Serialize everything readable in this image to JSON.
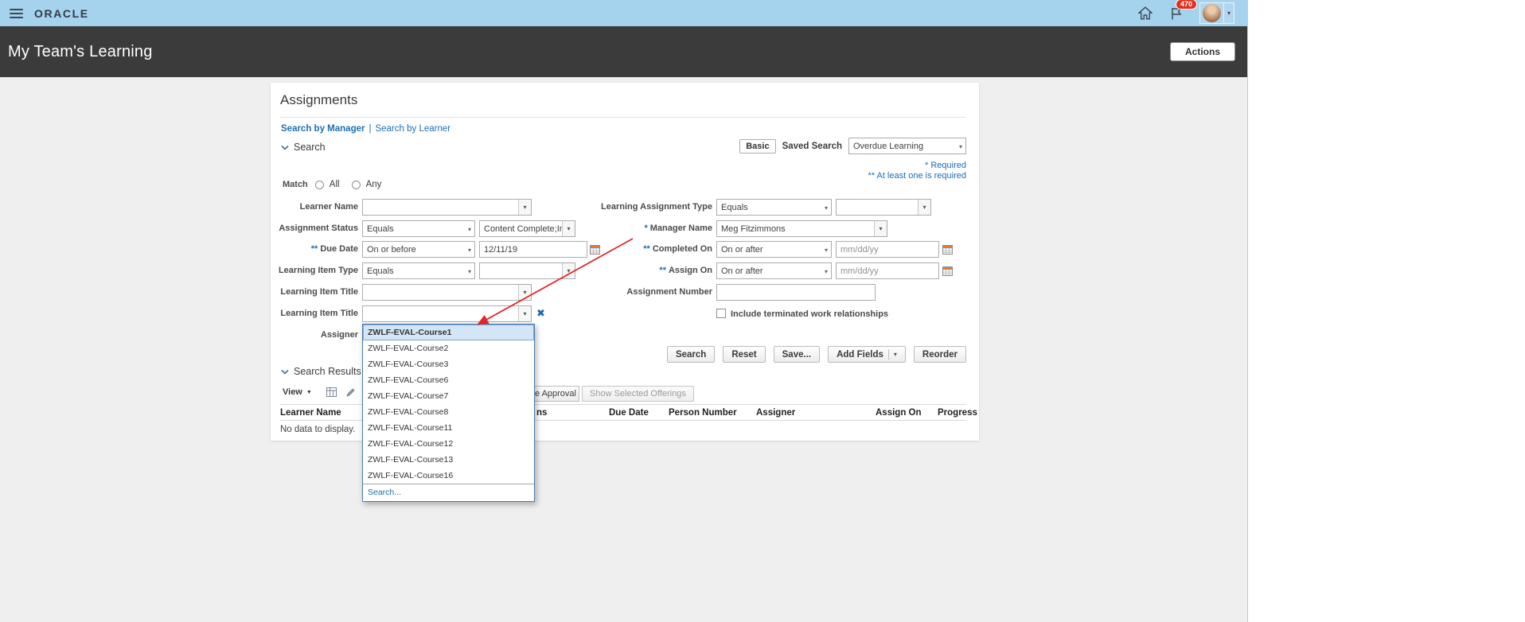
{
  "colors": {
    "topbar_bg": "#A5D2ED",
    "header_bg": "#3B3B3B",
    "link_blue": "#1A6FB5",
    "badge_red": "#E0301E",
    "annotation_arrow_red": "#E32528",
    "selected_item_bg": "#D3E6F7"
  },
  "topbar": {
    "brand": "ORACLE",
    "notification_count": "470"
  },
  "page_header": {
    "title": "My Team's Learning",
    "actions_button": "Actions"
  },
  "assignments": {
    "title": "Assignments",
    "search_by_manager": "Search by Manager",
    "separator": "|",
    "search_by_learner": "Search by Learner"
  },
  "search": {
    "section_title": "Search",
    "basic_button": "Basic",
    "saved_search_label": "Saved Search",
    "saved_search_value": "Overdue Learning",
    "required_note": "* Required",
    "at_least_one_note": "** At least one is required",
    "match_label": "Match",
    "match_all": "All",
    "match_any": "Any",
    "fields": {
      "learner_name": {
        "label": "Learner Name",
        "value": ""
      },
      "learning_assignment_type": {
        "label": "Learning Assignment Type",
        "operator": "Equals",
        "value": ""
      },
      "assignment_status": {
        "label": "Assignment Status",
        "operator": "Equals",
        "value": "Content Complete;In "
      },
      "manager_name": {
        "label": "Manager Name",
        "required_marker": "*",
        "value": "Meg Fitzimmons"
      },
      "due_date": {
        "label": "Due Date",
        "required_marker": "**",
        "operator": "On or before",
        "value": "12/11/19"
      },
      "completed_on": {
        "label": "Completed On",
        "required_marker": "**",
        "operator": "On or after",
        "placeholder": "mm/dd/yy"
      },
      "learning_item_type": {
        "label": "Learning Item Type",
        "operator": "Equals",
        "value": ""
      },
      "assign_on": {
        "label": "Assign On",
        "required_marker": "**",
        "operator": "On or after",
        "placeholder": "mm/dd/yy"
      },
      "learning_item_title_1": {
        "label": "Learning Item Title",
        "value": ""
      },
      "assignment_number": {
        "label": "Assignment Number",
        "value": ""
      },
      "learning_item_title_2": {
        "label": "Learning Item Title",
        "value": ""
      },
      "include_terminated": {
        "label": "Include terminated work relationships",
        "checked": false
      },
      "assigner": {
        "label": "Assigner"
      }
    },
    "buttons": {
      "search": "Search",
      "reset": "Reset",
      "save": "Save...",
      "add_fields": "Add Fields",
      "reorder": "Reorder"
    }
  },
  "dropdown": {
    "items": [
      "ZWLF-EVAL-Course1",
      "ZWLF-EVAL-Course2",
      "ZWLF-EVAL-Course3",
      "ZWLF-EVAL-Course6",
      "ZWLF-EVAL-Course7",
      "ZWLF-EVAL-Course8",
      "ZWLF-EVAL-Course11",
      "ZWLF-EVAL-Course12",
      "ZWLF-EVAL-Course13",
      "ZWLF-EVAL-Course16"
    ],
    "selected_index": 0,
    "footer_link": "Search..."
  },
  "results": {
    "section_title": "Search Results",
    "view_menu": "View",
    "partial_button_label": "e Approval",
    "show_selected_offerings": "Show Selected Offerings",
    "columns": [
      "Learner Name",
      "ns",
      "Due Date",
      "Person Number",
      "Assigner",
      "Assign On",
      "Progress"
    ],
    "empty_message": "No data to display."
  }
}
